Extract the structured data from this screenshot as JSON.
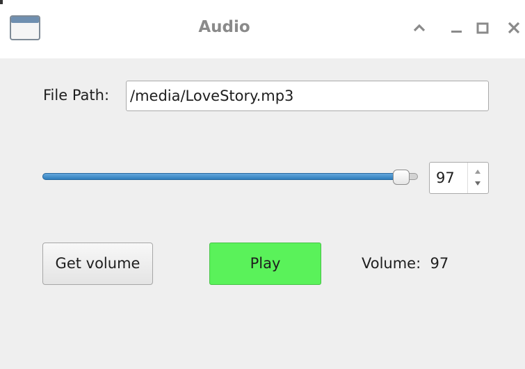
{
  "window": {
    "title": "Audio",
    "app_icon": "window-icon",
    "controls": [
      "chevron-up-icon",
      "minimize-icon",
      "maximize-icon",
      "close-icon"
    ]
  },
  "file_path": {
    "label": "File Path:",
    "value": "/media/LoveStory.mp3"
  },
  "volume_slider": {
    "value": 97,
    "min": 0,
    "max": 100
  },
  "volume_spinbox": {
    "value": "97"
  },
  "buttons": {
    "get_volume_label": "Get volume",
    "play_label": "Play"
  },
  "volume_display": {
    "label": "Volume:",
    "value": "97"
  },
  "colors": {
    "play_button": "#5af25a",
    "slider_fill": "#3d8fcf",
    "window_background": "#efefef",
    "title_text": "#8a8a8a"
  }
}
